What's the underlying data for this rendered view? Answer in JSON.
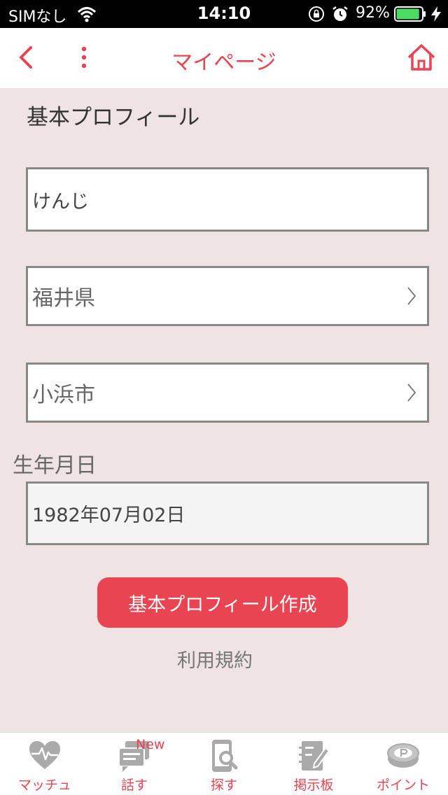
{
  "status_bar": {
    "carrier": "SIMなし",
    "time": "14:10",
    "battery_percent": "92%",
    "battery_level": 0.92
  },
  "nav": {
    "title": "マイページ"
  },
  "profile": {
    "section_title": "基本プロフィール",
    "name_value": "けんじ",
    "prefecture_value": "福井県",
    "city_value": "小浜市",
    "birthdate_label": "生年月日",
    "birthdate_value": "1982年07月02日",
    "create_button_label": "基本プロフィール作成",
    "terms_link_label": "利用規約"
  },
  "tab_bar": {
    "items": [
      {
        "label": "マッチュ",
        "icon": "heart-pulse-icon"
      },
      {
        "label": "話す",
        "icon": "chat-icon",
        "badge": "New"
      },
      {
        "label": "探す",
        "icon": "phone-search-icon"
      },
      {
        "label": "掲示板",
        "icon": "board-edit-icon"
      },
      {
        "label": "ポイント",
        "icon": "points-coin-icon"
      }
    ]
  },
  "colors": {
    "accent": "#e84452",
    "background": "#efe3e3",
    "icon_gray": "#aaaaaa"
  }
}
